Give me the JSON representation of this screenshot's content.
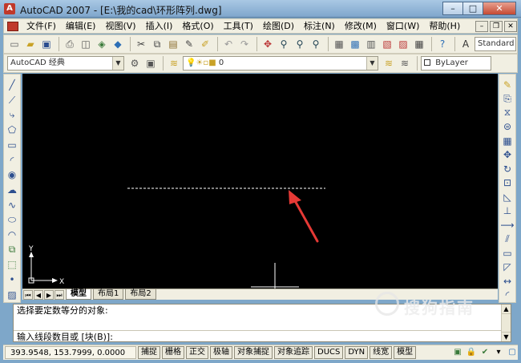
{
  "window": {
    "title": "AutoCAD 2007 - [E:\\我的cad\\环形阵列.dwg]",
    "minimize": "–",
    "maximize": "□",
    "close": "✕"
  },
  "menu": {
    "items": [
      "文件(F)",
      "编辑(E)",
      "视图(V)",
      "插入(I)",
      "格式(O)",
      "工具(T)",
      "绘图(D)",
      "标注(N)",
      "修改(M)",
      "窗口(W)",
      "帮助(H)"
    ]
  },
  "toolbar": {
    "text_style": "Standard",
    "workspace": "AutoCAD 经典",
    "layer": "0",
    "linetype": "ByLayer"
  },
  "canvas": {
    "ucs_x_label": "X",
    "ucs_y_label": "Y"
  },
  "tabs": [
    "模型",
    "布局1",
    "布局2"
  ],
  "command": {
    "line1": "选择要定数等分的对象:",
    "line2": "输入线段数目或 [块(B)]:"
  },
  "status": {
    "coords": "393.9548, 153.7999, 0.0000",
    "buttons": [
      "捕捉",
      "栅格",
      "正交",
      "极轴",
      "对象捕捉",
      "对象追踪",
      "DUCS",
      "DYN",
      "线宽",
      "模型"
    ]
  },
  "watermark": {
    "text": "搜狗指南"
  },
  "colors": {
    "canvas_bg": "#000000",
    "arrow": "#e53935",
    "dashed_line": "#ffffff"
  }
}
